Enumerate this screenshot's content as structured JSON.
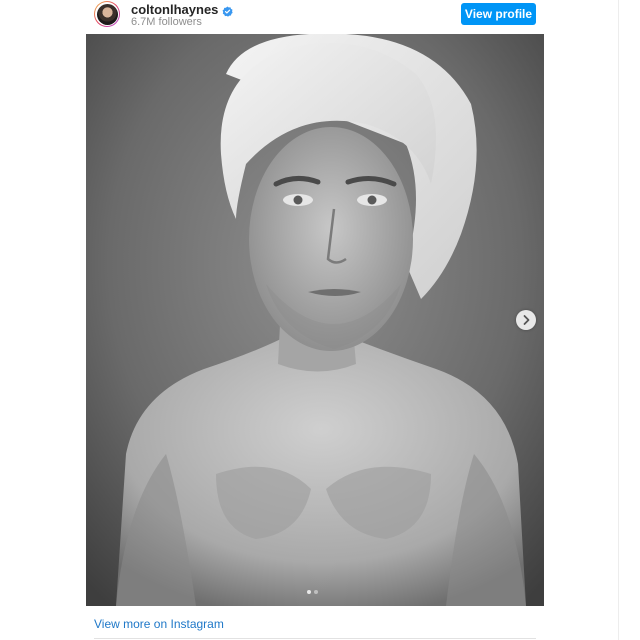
{
  "post": {
    "username": "coltonlhaynes",
    "followers": "6.7M followers",
    "verified": true,
    "view_profile_label": "View profile",
    "view_more_label": "View more on Instagram",
    "carousel": {
      "current": 1,
      "total": 2
    }
  },
  "icons": {
    "verified": "verified-badge-icon",
    "next": "chevron-right-icon"
  },
  "colors": {
    "accent": "#0095f6",
    "link": "#1f78c8",
    "verified": "#3897f0"
  }
}
